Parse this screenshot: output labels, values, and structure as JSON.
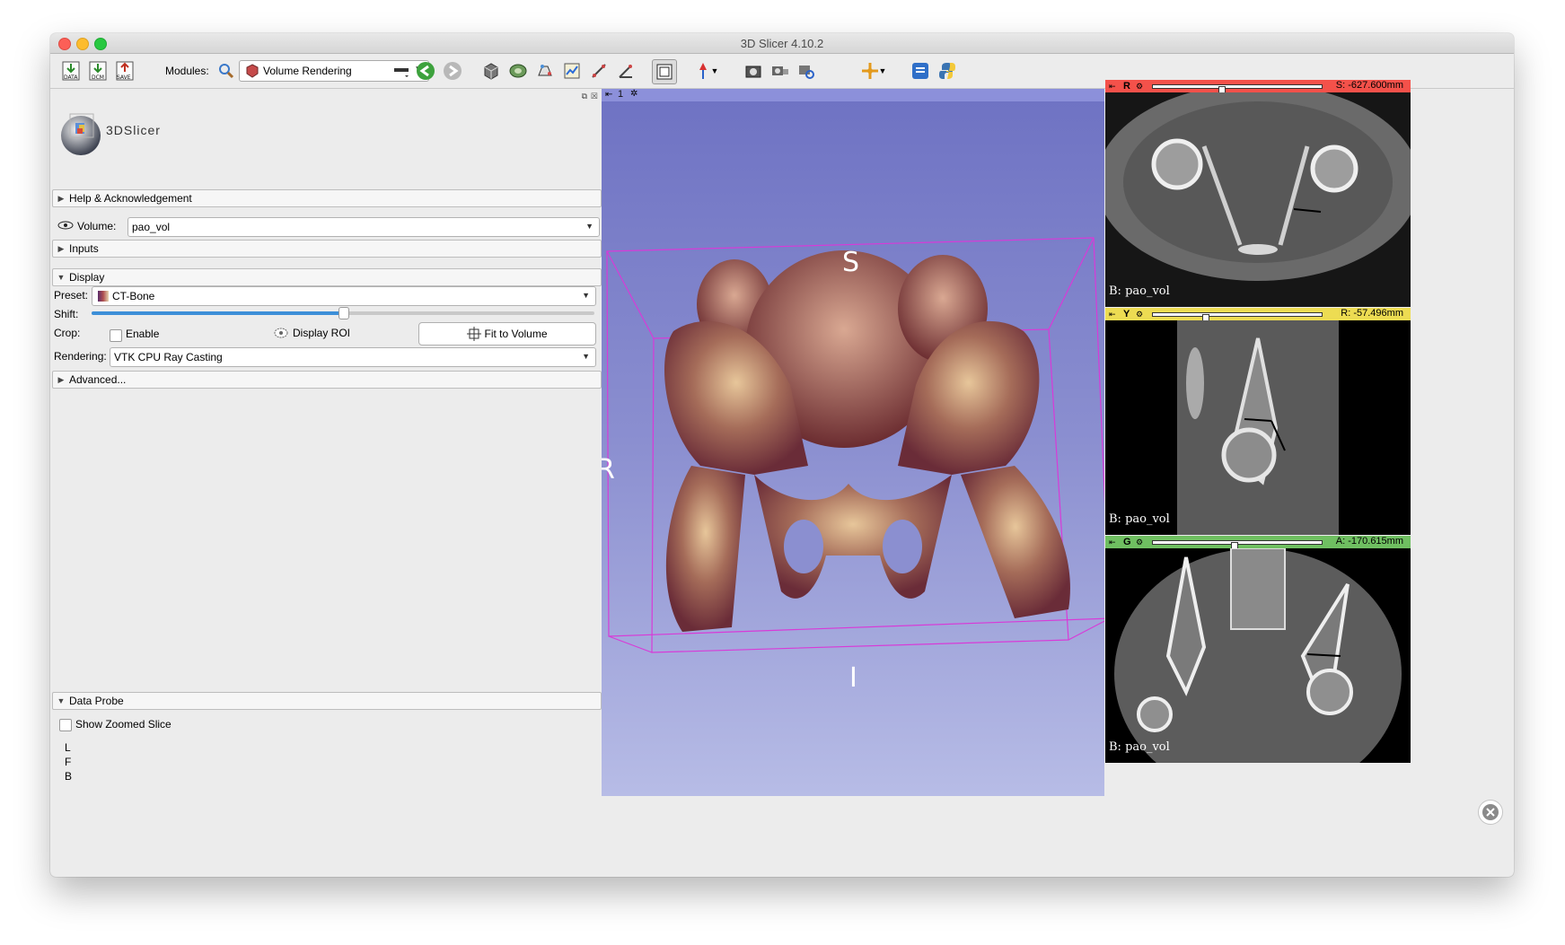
{
  "window": {
    "title": "3D Slicer 4.10.2"
  },
  "toolbar": {
    "modules_label": "Modules:",
    "module_selected": "Volume Rendering",
    "data_label": "DATA",
    "dcm_label": "DCM",
    "save_label": "SAVE"
  },
  "module_panel": {
    "logo_text": "3DSlicer",
    "help_section": "Help & Acknowledgement",
    "volume_label": "Volume:",
    "volume_value": "pao_vol",
    "inputs_section": "Inputs",
    "display_section": "Display",
    "preset_label": "Preset:",
    "preset_value": "CT-Bone",
    "shift_label": "Shift:",
    "shift_fraction": 0.5,
    "crop_label": "Crop:",
    "enable_label": "Enable",
    "display_roi_label": "Display ROI",
    "fit_button": "Fit to Volume",
    "rendering_label": "Rendering:",
    "rendering_value": "VTK CPU Ray Casting",
    "advanced_section": "Advanced...",
    "data_probe_section": "Data Probe",
    "show_zoomed_label": "Show Zoomed Slice",
    "probe_lines": [
      "L",
      "F",
      "B"
    ]
  },
  "view3d": {
    "view_number": "1",
    "orient_s": "S",
    "orient_i": "I",
    "orient_r": "R"
  },
  "slices": [
    {
      "id": "R",
      "color": "#f4514a",
      "offset": "S: -627.600mm",
      "slider": 0.4,
      "label": "B: pao_vol"
    },
    {
      "id": "Y",
      "color": "#eddc52",
      "offset": "R: -57.496mm",
      "slider": 0.3,
      "label": "B: pao_vol"
    },
    {
      "id": "G",
      "color": "#6fbf61",
      "offset": "A: -170.615mm",
      "slider": 0.48,
      "label": "B: pao_vol"
    }
  ]
}
